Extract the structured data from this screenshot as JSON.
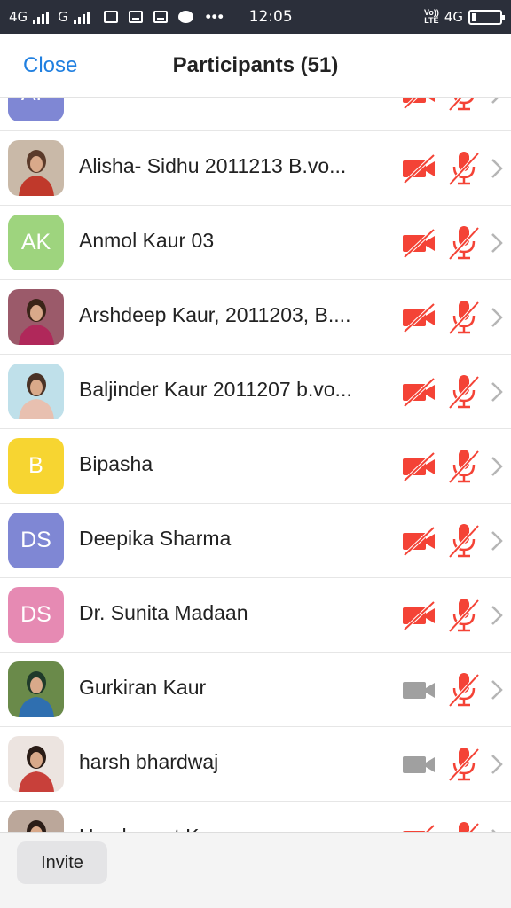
{
  "status_bar": {
    "network1": "4G",
    "network2": "G",
    "time": "12:05",
    "volte_line1": "Vo))",
    "volte_line2": "LTE",
    "network3": "4G",
    "battery_level": 0.12
  },
  "header": {
    "close_label": "Close",
    "title": "Participants (51)"
  },
  "colors": {
    "accent": "#1f7fe0",
    "muted": "#f44336",
    "video_on": "#a0a0a0",
    "chevron": "#b5b5b5"
  },
  "participants": [
    {
      "name": "Aamena Peerzada",
      "avatar_type": "initials",
      "initials": "AP",
      "avatar_color": "#7f87d4",
      "video_muted": true,
      "audio_muted": true
    },
    {
      "name": "Alisha- Sidhu 2011213 B.vo...",
      "avatar_type": "photo",
      "avatar_icon": "photo-avatar-icon",
      "video_muted": true,
      "audio_muted": true
    },
    {
      "name": "Anmol Kaur 03",
      "avatar_type": "initials",
      "initials": "AK",
      "avatar_color": "#9ed47e",
      "video_muted": true,
      "audio_muted": true
    },
    {
      "name": "Arshdeep Kaur, 2011203, B....",
      "avatar_type": "photo",
      "avatar_icon": "photo-avatar-icon",
      "video_muted": true,
      "audio_muted": true
    },
    {
      "name": "Baljinder Kaur 2011207 b.vo...",
      "avatar_type": "photo",
      "avatar_icon": "photo-avatar-icon",
      "video_muted": true,
      "audio_muted": true
    },
    {
      "name": "Bipasha",
      "avatar_type": "initials",
      "initials": "B",
      "avatar_color": "#f7d531",
      "video_muted": true,
      "audio_muted": true
    },
    {
      "name": "Deepika Sharma",
      "avatar_type": "initials",
      "initials": "DS",
      "avatar_color": "#7f87d4",
      "video_muted": true,
      "audio_muted": true
    },
    {
      "name": "Dr. Sunita Madaan",
      "avatar_type": "initials",
      "initials": "DS",
      "avatar_color": "#e68ab3",
      "video_muted": true,
      "audio_muted": true
    },
    {
      "name": "Gurkiran Kaur",
      "avatar_type": "photo",
      "avatar_icon": "photo-avatar-icon",
      "video_muted": false,
      "audio_muted": true
    },
    {
      "name": "harsh bhardwaj",
      "avatar_type": "photo",
      "avatar_icon": "photo-avatar-icon",
      "video_muted": false,
      "audio_muted": true
    },
    {
      "name": "Harshpreet Kaur",
      "avatar_type": "photo",
      "avatar_icon": "photo-avatar-icon",
      "video_muted": true,
      "audio_muted": true
    }
  ],
  "footer": {
    "invite_label": "Invite"
  }
}
